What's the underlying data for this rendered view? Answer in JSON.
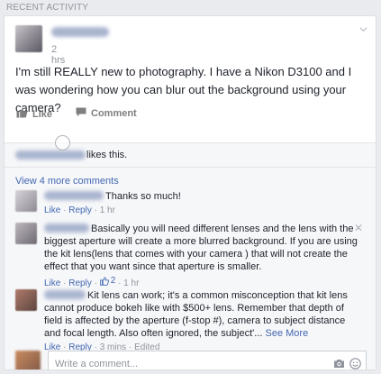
{
  "section": {
    "label": "RECENT ACTIVITY"
  },
  "post": {
    "time": "2 hrs",
    "text": "I'm still REALLY new to photography. I have a Nikon D3100 and I was wondering how you can blur out the background using your camera?"
  },
  "actions": {
    "like_label": "Like",
    "comment_label": "Comment"
  },
  "likes": {
    "suffix": "likes this."
  },
  "comments": {
    "view_more_label": "View 4 more comments",
    "items": [
      {
        "text": "Thanks so much!",
        "like": "Like",
        "reply": "Reply",
        "time": "1 hr"
      },
      {
        "text": "Basically you will need different lenses and the lens with the biggest aperture will create a more blurred background. If you are using the kit lens(lens that comes with your camera ) that will not create the effect that you want since that aperture is smaller.",
        "like": "Like",
        "reply": "Reply",
        "like_count": "2",
        "time": "1 hr"
      },
      {
        "text": "Kit lens can work; it's a common misconception that kit lens cannot produce bokeh like with $500+ lens. Remember that depth of field is affected by the aperture (f-stop #), camera to subject distance and focal length. Also often ignored, the subject'...",
        "see_more": "See More",
        "like": "Like",
        "reply": "Reply",
        "time": "3 mins",
        "edited": "Edited"
      }
    ]
  },
  "composer": {
    "placeholder": "Write a comment..."
  },
  "colors": {
    "link": "#4267b2",
    "meta": "#90949c",
    "background": "#e9ebee"
  }
}
